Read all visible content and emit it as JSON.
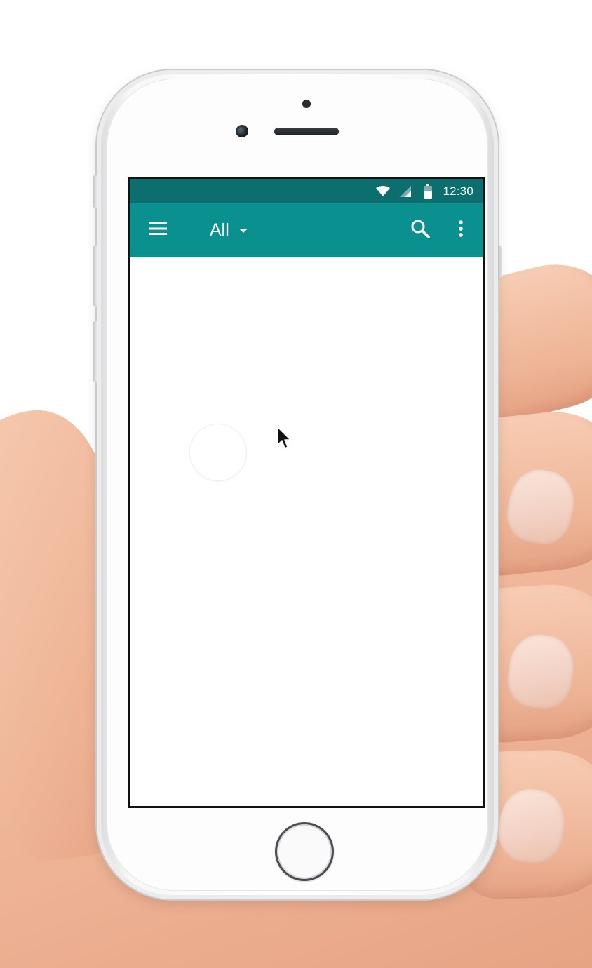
{
  "colors": {
    "status_bar": "#0c6e6e",
    "app_bar": "#0b9090",
    "screen_bg": "#ffffff"
  },
  "status_bar": {
    "wifi_icon": "wifi-icon",
    "signal_icon": "cell-signal-icon",
    "battery_icon": "battery-icon",
    "time": "12:30"
  },
  "app_bar": {
    "menu_icon": "hamburger-menu-icon",
    "spinner_label": "All",
    "spinner_icon": "dropdown-arrow-icon",
    "search_icon": "search-icon",
    "more_icon": "more-vert-icon"
  },
  "content": {
    "touch_indicator": "touch-ripple"
  },
  "cursor": "mouse-pointer-icon"
}
